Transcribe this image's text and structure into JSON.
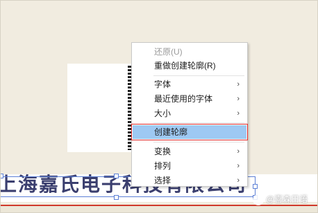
{
  "canvas": {
    "text": "上海嘉氏电子科技有限公司"
  },
  "menu": {
    "items": [
      {
        "label": "还原(U)",
        "disabled": true
      },
      {
        "label": "重做创建轮廓(R)"
      },
      {
        "label": "字体",
        "submenu": true
      },
      {
        "label": "最近使用的字体",
        "submenu": true
      },
      {
        "label": "大小",
        "submenu": true
      },
      {
        "label": "创建轮廓",
        "highlighted": true
      },
      {
        "label": "变换",
        "submenu": true
      },
      {
        "label": "排列",
        "submenu": true
      },
      {
        "label": "选择",
        "submenu": true
      }
    ],
    "submenu_glyph": "›"
  },
  "watermark": {
    "text": "@喜森日语"
  },
  "colors": {
    "background": "#f1ece0",
    "highlight": "#9ec9f3",
    "highlight_border": "#e02b2b",
    "outline_text": "#3b3f6f",
    "accent_line": "#d0392b"
  }
}
